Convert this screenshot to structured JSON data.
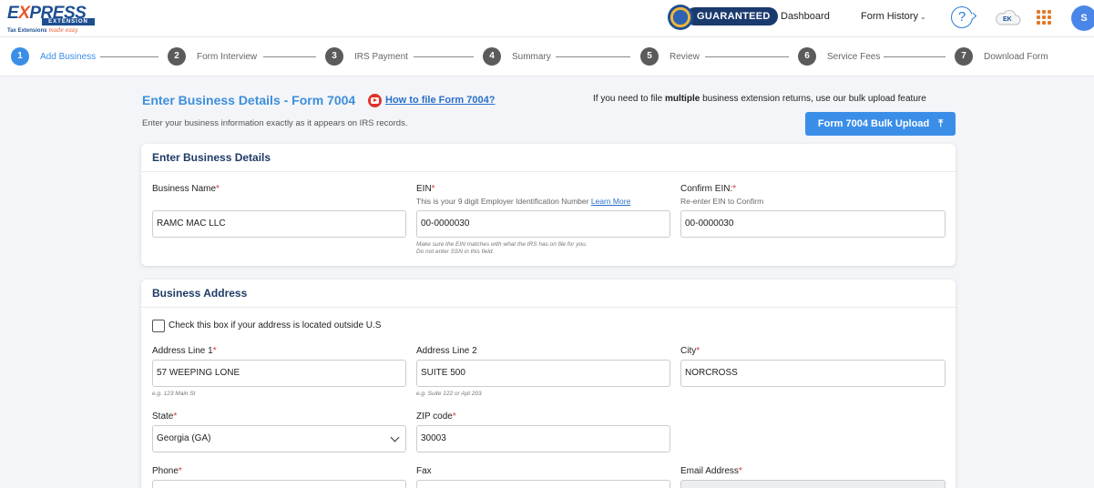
{
  "header": {
    "logo": {
      "brand_ex": "E",
      "brand_x": "X",
      "brand_rest": "PRESS",
      "banner": "EXTENSION",
      "tagline": "Tax Extensions",
      "tagline_script": "made easy"
    },
    "guaranteed_badge": "GUARANTEED",
    "nav": {
      "dashboard": "Dashboard",
      "form_history": "Form History"
    },
    "help_icon_glyph": "?",
    "avatar_initial": "S"
  },
  "stepper": [
    {
      "num": "1",
      "label": "Add Business",
      "active": true
    },
    {
      "num": "2",
      "label": "Form Interview",
      "active": false
    },
    {
      "num": "3",
      "label": "IRS Payment",
      "active": false
    },
    {
      "num": "4",
      "label": "Summary",
      "active": false
    },
    {
      "num": "5",
      "label": "Review",
      "active": false
    },
    {
      "num": "6",
      "label": "Service Fees",
      "active": false
    },
    {
      "num": "7",
      "label": "Download Form",
      "active": false
    }
  ],
  "page": {
    "title": "Enter Business Details - Form 7004",
    "how_to_link": "How to file Form 7004?",
    "subtitle": "Enter your business information exactly as it appears on IRS records.",
    "bulk_note_pre": "If you need to file ",
    "bulk_note_bold": "multiple",
    "bulk_note_post": " business extension returns, use our bulk upload feature",
    "bulk_button": "Form 7004 Bulk Upload"
  },
  "business_details": {
    "heading": "Enter Business Details",
    "business_name": {
      "label": "Business Name",
      "value": "RAMC MAC LLC"
    },
    "ein": {
      "label": "EIN",
      "help": "This is your 9 digit Employer Identification Number",
      "help_link": "Learn More",
      "value": "00-0000030",
      "hint_1": "Make sure the EIN matches with what the IRS has on file for you.",
      "hint_2": "Do not enter SSN in this field."
    },
    "confirm_ein": {
      "label": "Confirm EIN:",
      "help": "Re-enter EIN to Confirm",
      "value": "00-0000030"
    }
  },
  "business_address": {
    "heading": "Business Address",
    "outside_us_label": "Check this box if your address is located outside U.S",
    "address1": {
      "label": "Address Line 1",
      "value": "57 WEEPING LONE",
      "hint": "e.g. 123 Main St"
    },
    "address2": {
      "label": "Address Line 2",
      "value": "SUITE 500",
      "hint": "e.g. Suite 122 or Apt 203"
    },
    "city": {
      "label": "City",
      "value": "NORCROSS"
    },
    "state": {
      "label": "State",
      "value": "Georgia (GA)"
    },
    "zip": {
      "label": "ZIP code",
      "value": "30003"
    },
    "phone": {
      "label": "Phone"
    },
    "fax": {
      "label": "Fax"
    },
    "email": {
      "label": "Email Address"
    }
  },
  "colors": {
    "accent": "#3b8ee8",
    "heading": "#1f3b66",
    "required": "#d03a3a",
    "step_inactive": "#5b5b5b"
  }
}
